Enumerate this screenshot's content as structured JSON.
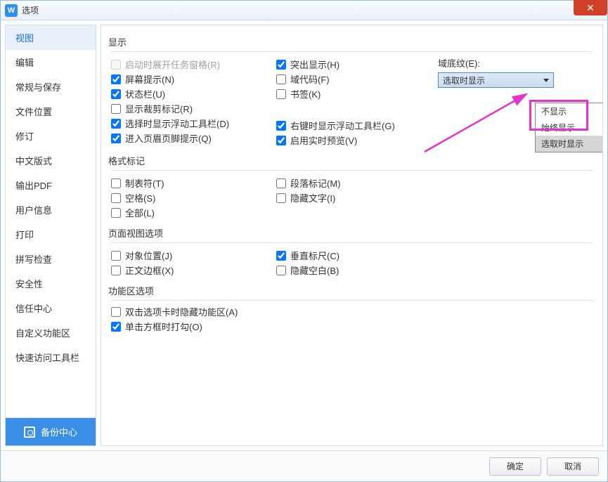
{
  "window": {
    "title": "选项",
    "app_glyph": "W"
  },
  "sidebar": {
    "items": [
      "视图",
      "编辑",
      "常规与保存",
      "文件位置",
      "修订",
      "中文版式",
      "输出PDF",
      "用户信息",
      "打印",
      "拼写检查",
      "安全性",
      "信任中心",
      "自定义功能区",
      "快速访问工具栏"
    ],
    "active_index": 0,
    "backup": "备份中心"
  },
  "sections": {
    "display": {
      "title": "显示",
      "left": [
        {
          "label": "启动时展开任务窗格(R)",
          "checked": false,
          "disabled": true
        },
        {
          "label": "屏幕提示(N)",
          "checked": true
        },
        {
          "label": "状态栏(U)",
          "checked": true
        },
        {
          "label": "显示裁剪标记(R)",
          "checked": false
        },
        {
          "label": "选择时显示浮动工具栏(D)",
          "checked": true
        },
        {
          "label": "进入页眉页脚提示(Q)",
          "checked": true
        }
      ],
      "mid": [
        {
          "label": "突出显示(H)",
          "checked": true
        },
        {
          "label": "域代码(F)",
          "checked": false
        },
        {
          "label": "书签(K)",
          "checked": false
        },
        {
          "label": "",
          "checked": false,
          "blank": true
        },
        {
          "label": "右键时显示浮动工具栏(G)",
          "checked": true
        },
        {
          "label": "启用实时预览(V)",
          "checked": true
        }
      ],
      "shading": {
        "label": "域底纹(E):",
        "value": "选取时显示",
        "options": [
          "不显示",
          "始终显示",
          "选取时显示"
        ]
      }
    },
    "format": {
      "title": "格式标记",
      "left": [
        {
          "label": "制表符(T)",
          "checked": false
        },
        {
          "label": "空格(S)",
          "checked": false
        },
        {
          "label": "全部(L)",
          "checked": false
        }
      ],
      "mid": [
        {
          "label": "段落标记(M)",
          "checked": false
        },
        {
          "label": "隐藏文字(I)",
          "checked": false
        }
      ]
    },
    "page": {
      "title": "页面视图选项",
      "left": [
        {
          "label": "对象位置(J)",
          "checked": false
        },
        {
          "label": "正文边框(X)",
          "checked": false
        }
      ],
      "mid": [
        {
          "label": "垂直标尺(C)",
          "checked": true
        },
        {
          "label": "隐藏空白(B)",
          "checked": false
        }
      ]
    },
    "ribbon": {
      "title": "功能区选项",
      "items": [
        {
          "label": "双击选项卡时隐藏功能区(A)",
          "checked": false
        },
        {
          "label": "单击方框时打勾(O)",
          "checked": true
        }
      ]
    }
  },
  "footer": {
    "ok": "确定",
    "cancel": "取消"
  }
}
